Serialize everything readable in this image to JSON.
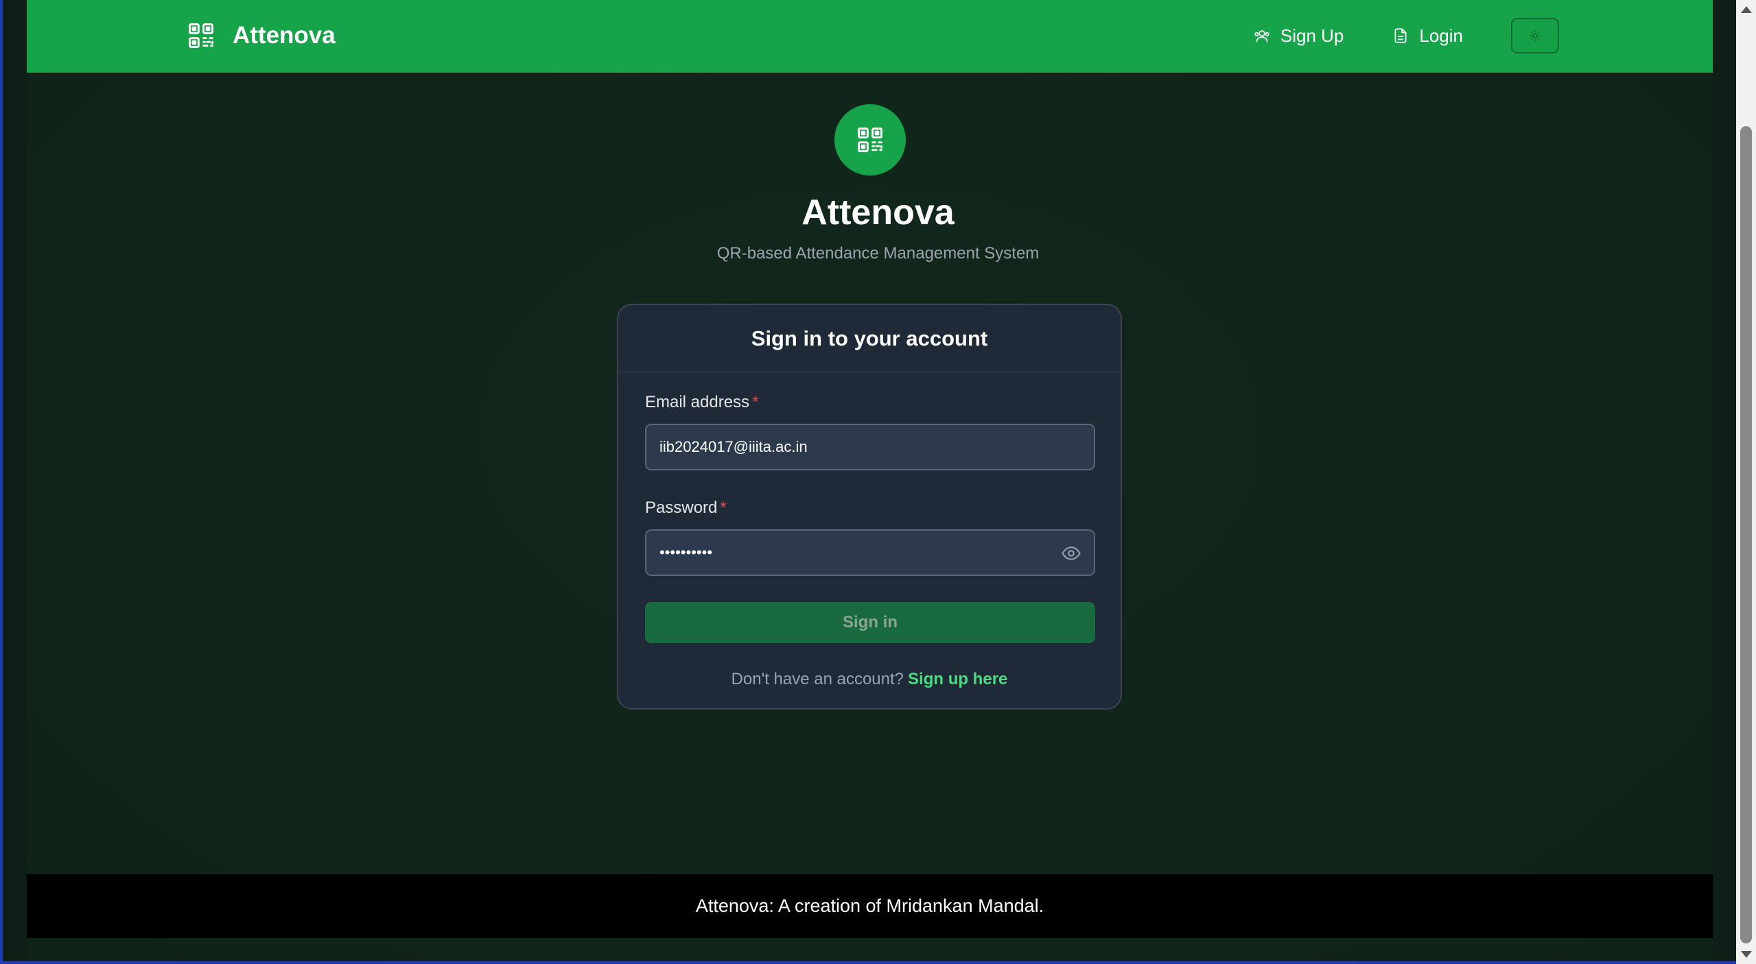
{
  "header": {
    "brand_name": "Attenova",
    "nav": {
      "signup_label": "Sign Up",
      "login_label": "Login"
    }
  },
  "hero": {
    "title": "Attenova",
    "subtitle": "QR-based Attendance Management System"
  },
  "login_form": {
    "heading": "Sign in to your account",
    "email_label": "Email address",
    "email_value": "iib2024017@iiita.ac.in",
    "password_label": "Password",
    "password_value": "••••••••••",
    "required_marker": "*",
    "submit_label": "Sign in",
    "signup_prompt": "Don't have an account?",
    "signup_link": "Sign up here"
  },
  "footer": {
    "text": "Attenova: A creation of Mridankan Mandal."
  },
  "colors": {
    "brand_green": "#16a34a",
    "background": "#11261b",
    "card": "#1f2937",
    "link_green": "#4ade80",
    "required_red": "#ef4444"
  },
  "icons": {
    "brand": "qr-code-icon",
    "signup": "users-icon",
    "login": "document-icon",
    "theme": "sun-icon",
    "password_toggle": "eye-icon"
  }
}
